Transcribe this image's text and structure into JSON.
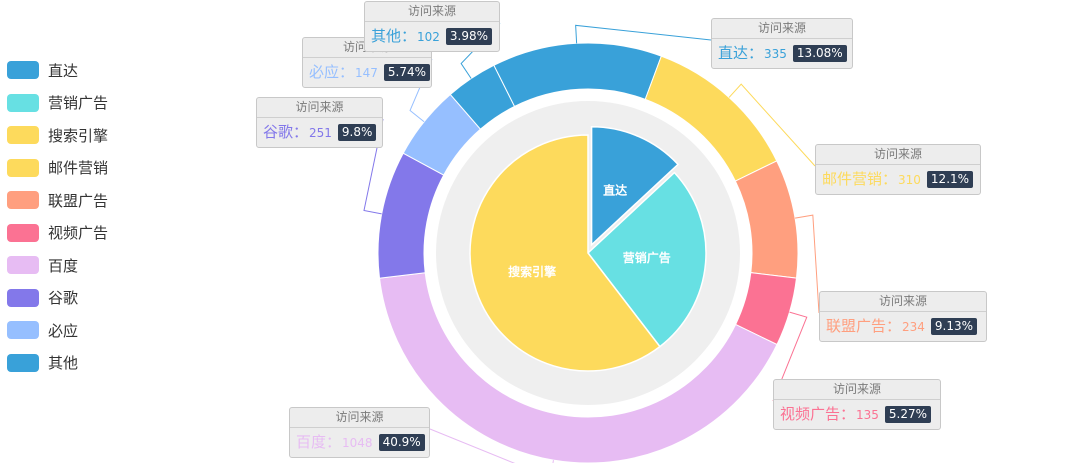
{
  "legend": {
    "items": [
      {
        "label": "直达",
        "color": "#39a1d9"
      },
      {
        "label": "营销广告",
        "color": "#67e0e3"
      },
      {
        "label": "搜索引擎",
        "color": "#fdda5c"
      },
      {
        "label": "邮件营销",
        "color": "#fdda5c"
      },
      {
        "label": "联盟广告",
        "color": "#ff9f7f"
      },
      {
        "label": "视频广告",
        "color": "#fb7293"
      },
      {
        "label": "百度",
        "color": "#e7bcf3"
      },
      {
        "label": "谷歌",
        "color": "#8378ea"
      },
      {
        "label": "必应",
        "color": "#96bfff"
      },
      {
        "label": "其他",
        "color": "#39a1d9"
      }
    ]
  },
  "chart_data": {
    "type": "pie",
    "series": [
      {
        "kind": "inner-pie",
        "slices": [
          {
            "name": "直达",
            "value": 335,
            "color": "#39a1d9",
            "selected": true
          },
          {
            "name": "营销广告",
            "value": 679,
            "color": "#67e0e3"
          },
          {
            "name": "搜索引擎",
            "value": 1548,
            "color": "#fdda5c"
          }
        ]
      },
      {
        "name": "访问来源",
        "kind": "outer-ring",
        "slices": [
          {
            "name": "直达",
            "value": 335,
            "percent": "13.08%",
            "color": "#39a1d9"
          },
          {
            "name": "邮件营销",
            "value": 310,
            "percent": "12.1%",
            "color": "#fdda5c"
          },
          {
            "name": "联盟广告",
            "value": 234,
            "percent": "9.13%",
            "color": "#ff9f7f"
          },
          {
            "name": "视频广告",
            "value": 135,
            "percent": "5.27%",
            "color": "#fb7293"
          },
          {
            "name": "百度",
            "value": 1048,
            "percent": "40.9%",
            "color": "#e7bcf3"
          },
          {
            "name": "谷歌",
            "value": 251,
            "percent": "9.8%",
            "color": "#8378ea"
          },
          {
            "name": "必应",
            "value": 147,
            "percent": "5.74%",
            "color": "#96bfff"
          },
          {
            "name": "其他",
            "value": 102,
            "percent": "3.98%",
            "color": "#39a1d9"
          }
        ]
      }
    ]
  }
}
